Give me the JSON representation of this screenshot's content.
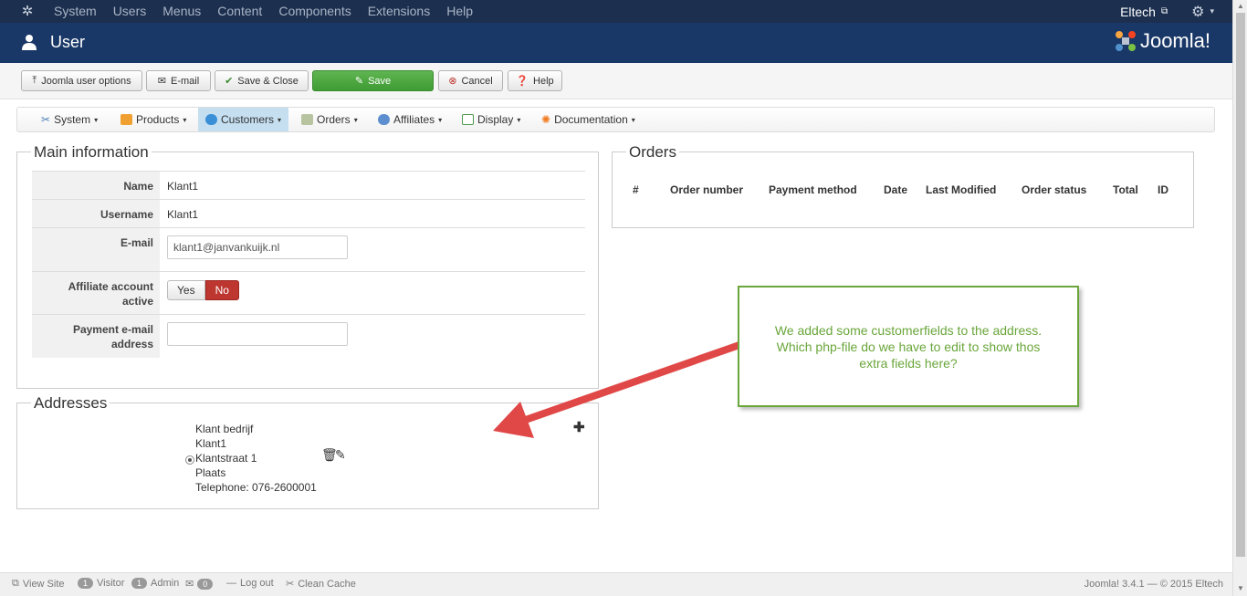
{
  "topbar": {
    "menu": [
      "System",
      "Users",
      "Menus",
      "Content",
      "Components",
      "Extensions",
      "Help"
    ],
    "user": "Eltech"
  },
  "header": {
    "title": "User",
    "brand": "Joomla!"
  },
  "toolbar": {
    "options_label": "Joomla user options",
    "email_label": "E-mail",
    "save_close_label": "Save & Close",
    "save_label": "Save",
    "cancel_label": "Cancel",
    "help_label": "Help"
  },
  "submenu": {
    "items": [
      {
        "label": "System"
      },
      {
        "label": "Products"
      },
      {
        "label": "Customers"
      },
      {
        "label": "Orders"
      },
      {
        "label": "Affiliates"
      },
      {
        "label": "Display"
      },
      {
        "label": "Documentation"
      }
    ]
  },
  "main": {
    "legend": "Main information",
    "name_label": "Name",
    "name_value": "Klant1",
    "username_label": "Username",
    "username_value": "Klant1",
    "email_label": "E-mail",
    "email_value": "klant1@janvankuijk.nl",
    "affiliate_label_1": "Affiliate account",
    "affiliate_label_2": "active",
    "yes_label": "Yes",
    "no_label": "No",
    "payment_label_1": "Payment e-mail",
    "payment_label_2": "address",
    "payment_value": ""
  },
  "orders": {
    "legend": "Orders",
    "columns": [
      "#",
      "Order number",
      "Payment method",
      "Date",
      "Last Modified",
      "Order status",
      "Total",
      "ID"
    ]
  },
  "addresses": {
    "legend": "Addresses",
    "lines": [
      "Klant bedrijf",
      "Klant1",
      "Klantstraat 1",
      "Plaats",
      "Telephone: 076-2600001"
    ]
  },
  "note": {
    "line1": "We added some customerfields to the address.",
    "line2": "Which php-file do we have to edit to show thos",
    "line3": "extra fields here?"
  },
  "footer": {
    "view_site": "View Site",
    "visitor_count": "1",
    "visitor_label": "Visitor",
    "admin_count": "1",
    "admin_label": "Admin",
    "messages_count": "0",
    "logout_label": "Log out",
    "clean_cache": "Clean Cache",
    "copyright": "Joomla! 3.4.1 — © 2015 Eltech"
  },
  "colors": {
    "topbar": "#1c2f4f",
    "header": "#1a3867",
    "save": "#46a03a",
    "no_active": "#bd362f",
    "note_border": "#6aa63b",
    "arrow": "#e04848"
  }
}
